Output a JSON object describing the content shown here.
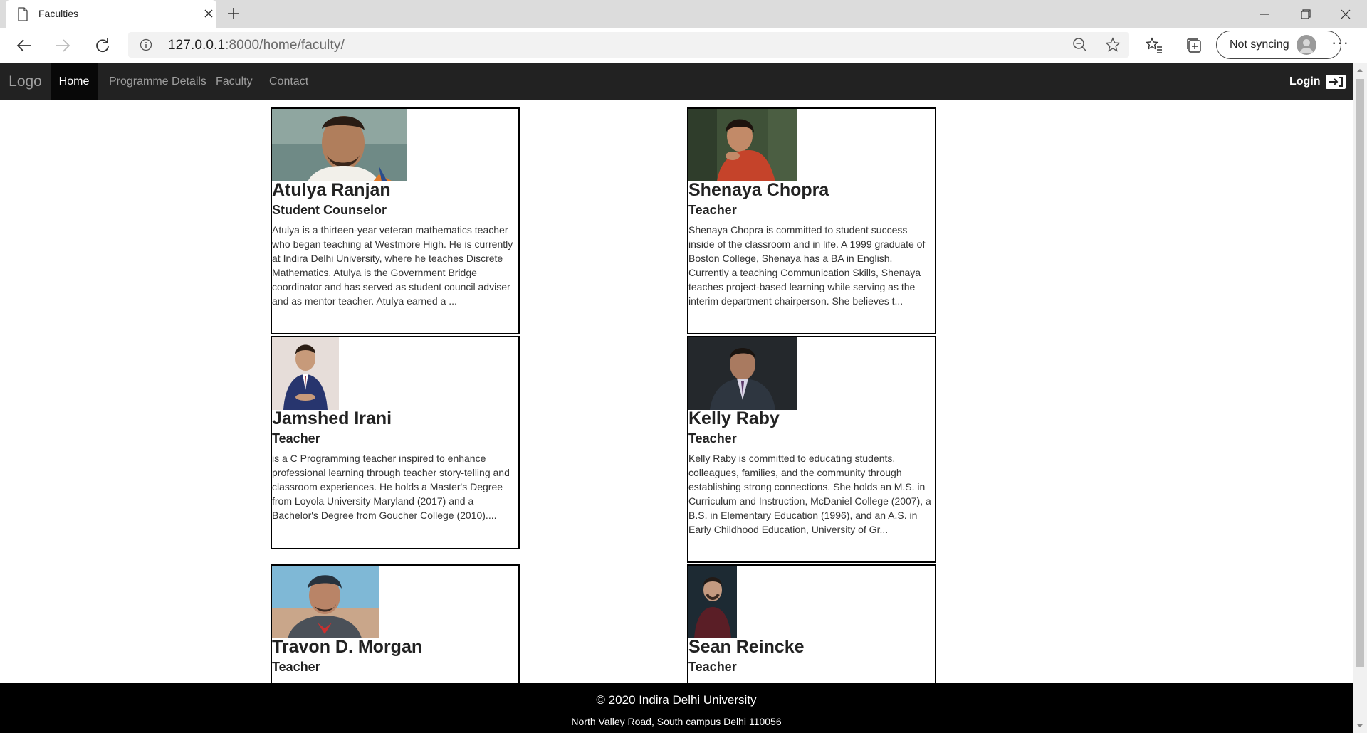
{
  "browser": {
    "tab_title": "Faculties",
    "url_host": "127.0.0.1",
    "url_rest": ":8000/home/faculty/",
    "sync_label": "Not syncing"
  },
  "nav": {
    "brand": "Logo",
    "items": [
      "Home",
      "Programme Details",
      "Faculty",
      "Contact"
    ],
    "active": "Home",
    "login": "Login"
  },
  "faculty": [
    {
      "name": "Atulya Ranjan",
      "role": "Student Counselor",
      "bio": "Atulya is a thirteen-year veteran mathematics teacher who began teaching at Westmore High. He is currently at Indira Delhi University, where he teaches Discrete Mathematics. Atulya is the Government Bridge coordinator and has served as student council adviser and as mentor teacher. Atulya earned a ..."
    },
    {
      "name": "Shenaya Chopra",
      "role": "Teacher",
      "bio": "Shenaya Chopra is committed to student success inside of the classroom and in life. A 1999 graduate of Boston College, Shenaya has a BA in English. Currently a teaching Communication Skills, Shenaya teaches project-based learning while serving as the interim department chairperson. She believes t..."
    },
    {
      "name": "Jamshed Irani",
      "role": "Teacher",
      "bio": "is a C Programming teacher inspired to enhance professional learning through teacher story-telling and classroom experiences. He holds a Master's Degree from Loyola University Maryland (2017) and a Bachelor's Degree from Goucher College (2010)...."
    },
    {
      "name": "Kelly Raby",
      "role": "Teacher",
      "bio": "Kelly Raby is committed to educating students, colleagues, families, and the community through establishing strong connections. She holds an M.S. in Curriculum and Instruction, McDaniel College (2007), a B.S. in Elementary Education (1996), and an A.S. in Early Childhood Education, University of Gr..."
    },
    {
      "name": "Travon D. Morgan",
      "role": "Teacher",
      "bio": ""
    },
    {
      "name": "Sean Reincke",
      "role": "Teacher",
      "bio": ""
    }
  ],
  "footer": {
    "copyright": "© 2020 Indira Delhi University",
    "address": "North Valley Road, South campus Delhi 110056"
  }
}
